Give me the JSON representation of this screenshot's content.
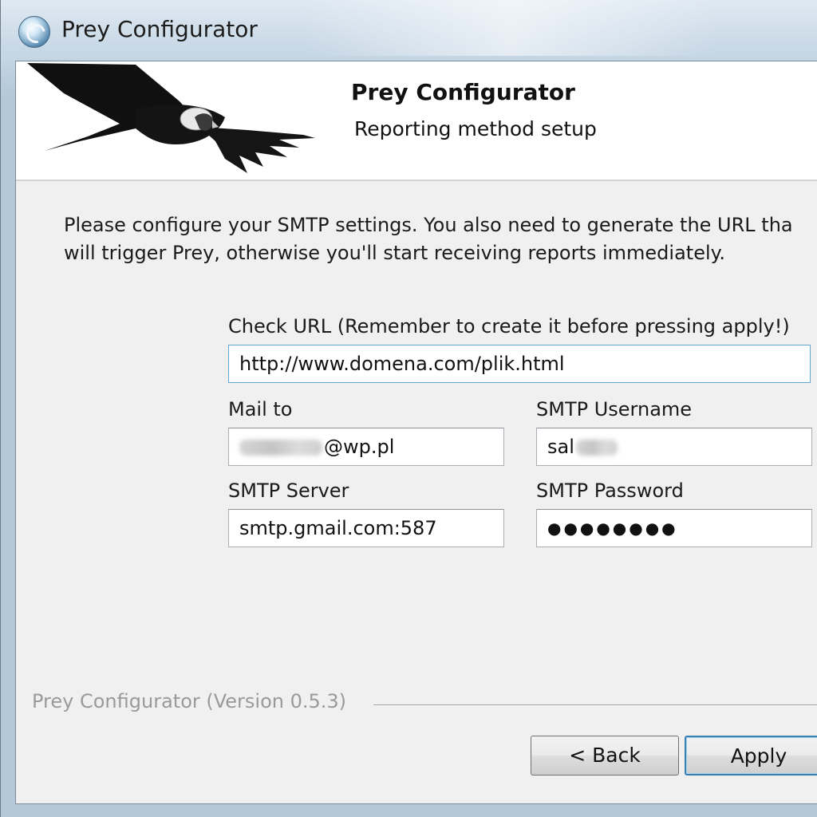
{
  "window": {
    "title": "Prey Configurator"
  },
  "header": {
    "title": "Prey Configurator",
    "subtitle": "Reporting method setup"
  },
  "intro": {
    "line1": "Please configure your SMTP settings. You also need to generate the URL tha",
    "line2": "will trigger Prey, otherwise you'll start receiving reports immediately."
  },
  "form": {
    "check_url_label": "Check URL (Remember to create it before pressing apply!)",
    "check_url_value": "http://www.domena.com/plik.html",
    "mail_to_label": "Mail to",
    "mail_to_value_visible": "@wp.pl",
    "smtp_username_label": "SMTP Username",
    "smtp_username_value_visible": "sal",
    "smtp_server_label": "SMTP Server",
    "smtp_server_value": "smtp.gmail.com:587",
    "smtp_password_label": "SMTP Password",
    "smtp_password_value": "●●●●●●●●"
  },
  "footer": {
    "version": "Prey Configurator (Version 0.5.3)",
    "back_label": "< Back",
    "apply_label": "Apply"
  },
  "icons": {
    "app": "prey-globe-icon",
    "logo": "condor-bird-logo"
  }
}
